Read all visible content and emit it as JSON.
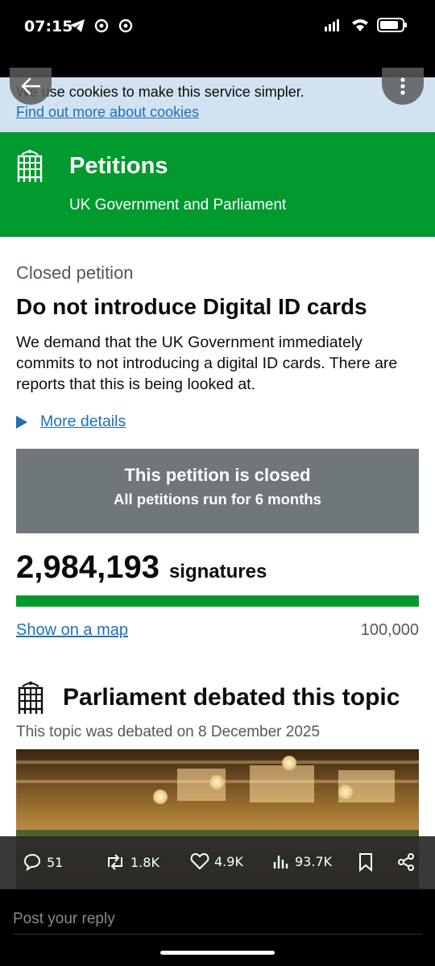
{
  "status_bar": {
    "time": "07:15"
  },
  "cookie_banner": {
    "text": "We use cookies to make this service simpler.",
    "link": "Find out more about cookies"
  },
  "header": {
    "title": "Petitions",
    "subtitle": "UK Government and Parliament"
  },
  "petition": {
    "status_label": "Closed petition",
    "title": "Do not introduce Digital ID cards",
    "description": "We demand that the UK Government immediately commits to not introducing a digital ID cards. There are reports that this is being looked at.",
    "details_link": "More details",
    "closed_box": {
      "title": "This petition is closed",
      "subtitle": "All petitions run for 6 months"
    },
    "signatures": "2,984,193",
    "signatures_label": "signatures",
    "progress_fraction": 1.0,
    "map_link": "Show on a map",
    "target": "100,000"
  },
  "debate": {
    "title": "Parliament debated this topic",
    "date_text": "This topic was debated on 8 December 2025"
  },
  "tweet_actions": {
    "replies": "51",
    "retweets": "1.8K",
    "likes": "4.9K",
    "views": "93.7K"
  },
  "reply": {
    "placeholder": "Post your reply"
  },
  "colors": {
    "brand_green": "#009a2e",
    "link_blue": "#1d70b8",
    "cookie_bg": "#d2e2f1",
    "closed_box_bg": "#6f777b"
  }
}
